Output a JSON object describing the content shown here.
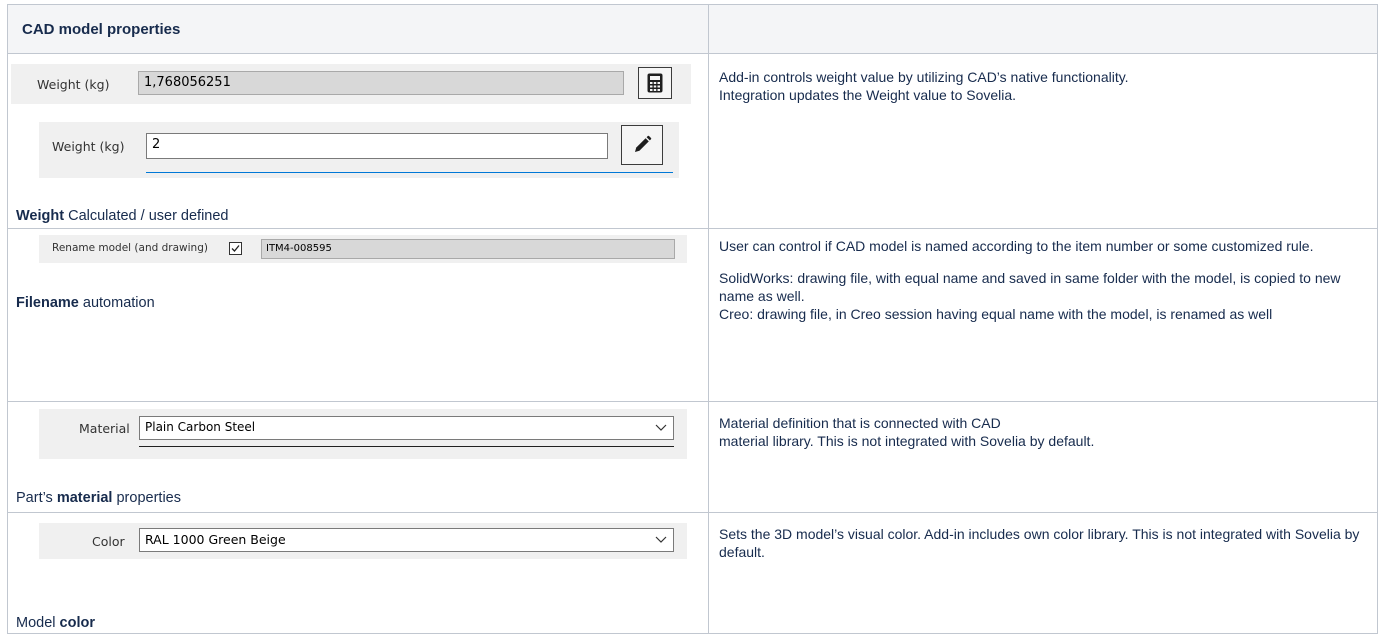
{
  "table": {
    "header": {
      "col1": "CAD model properties",
      "col2": ""
    },
    "rows": [
      {
        "weight": {
          "calc_label": "Weight (kg)",
          "calc_value": "1,768056251",
          "calc_icon": "calculator-icon",
          "user_label": "Weight (kg)",
          "user_value": "2",
          "user_icon": "pencil-icon"
        },
        "caption_bold": "Weight",
        "caption_rest": " Calculated / user defined",
        "description": [
          "Add-in controls weight value by utilizing CAD’s native functionality.",
          "Integration updates the Weight value to Sovelia."
        ]
      },
      {
        "rename": {
          "label": "Rename model (and drawing)",
          "checked": true,
          "value": "ITM4-008595"
        },
        "caption_bold": "Filename",
        "caption_rest": " automation",
        "description": [
          "User can control if CAD model is named according to the item number or some customized rule.",
          "SolidWorks: drawing file, with equal name and saved in same folder with the model, is copied to new name as well.",
          "Creo: drawing file, in Creo session having equal name with the model, is renamed as well"
        ]
      },
      {
        "material": {
          "label": "Material",
          "value": "Plain Carbon Steel"
        },
        "caption_pre": "Part’s ",
        "caption_bold": "material",
        "caption_rest": " properties",
        "description": [
          "Material definition that is connected with CAD",
          "material library. This is not integrated with Sovelia by default."
        ]
      },
      {
        "color": {
          "label": "Color",
          "value": "RAL 1000 Green Beige"
        },
        "caption_pre": "Model ",
        "caption_bold": "color",
        "description": [
          "Sets the 3D model’s visual color. Add-in includes own color library. This is not integrated with Sovelia by default."
        ]
      }
    ]
  }
}
